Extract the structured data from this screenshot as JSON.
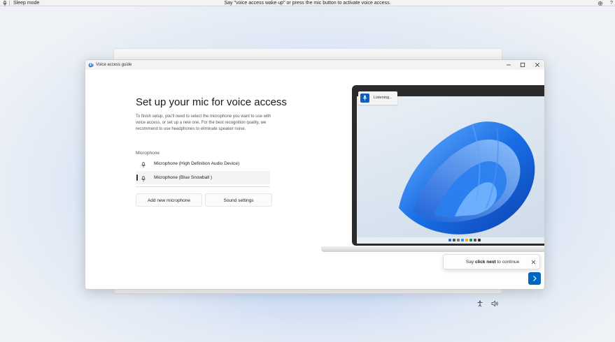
{
  "voice_access_bar": {
    "status": "Sleep mode",
    "message": "Say \"voice access wake up\" or press the mic button to activate voice access.",
    "help": "?",
    "icons": [
      "mic-icon",
      "gear-icon"
    ]
  },
  "window": {
    "title": "Voice access guide",
    "controls": [
      "minimize",
      "maximize",
      "close"
    ]
  },
  "setup": {
    "heading": "Set up your mic for voice access",
    "description": "To finish setup, you'll need to select the microphone you want to use with voice access, or set up a new one. For the best recognition quality, we recommend to use headphones to eliminate speaker noise.",
    "microphone_label": "Microphone",
    "microphones": [
      {
        "label": "Microphone (High Definition Audio Device)",
        "selected": false
      },
      {
        "label": "Microphone (Blue Snowball )",
        "selected": true
      }
    ],
    "add_button": "Add new microphone",
    "sound_settings_button": "Sound settings"
  },
  "illustration": {
    "listening_text": "Listening..."
  },
  "tooltip": {
    "prefix": "Say ",
    "bold": "click next",
    "suffix": " to continue"
  },
  "colors": {
    "accent": "#0067c0",
    "listening_mic": "#0f5fb8"
  }
}
